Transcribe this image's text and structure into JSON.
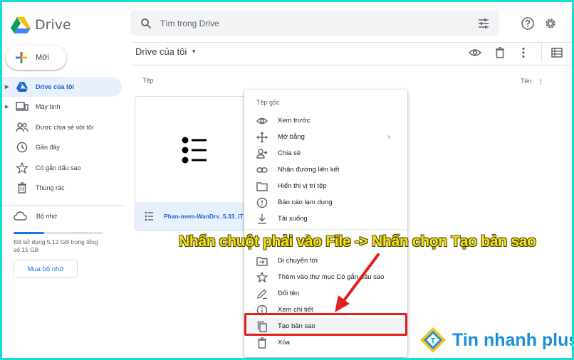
{
  "app": {
    "name": "Drive",
    "search_placeholder": "Tìm trong Drive"
  },
  "header_icons": [
    "search-icon",
    "tune-icon",
    "help-icon",
    "settings-icon"
  ],
  "sidebar": {
    "new_button": "Mới",
    "items": [
      {
        "label": "Drive của tôi",
        "icon": "drive-icon",
        "active": true,
        "has_caret": true
      },
      {
        "label": "Máy tính",
        "icon": "computer-icon",
        "active": false,
        "has_caret": true
      },
      {
        "label": "Được chia sẻ với tôi",
        "icon": "people-icon",
        "active": false,
        "has_caret": false
      },
      {
        "label": "Gần đây",
        "icon": "clock-icon",
        "active": false,
        "has_caret": false
      },
      {
        "label": "Có gắn dấu sao",
        "icon": "star-icon",
        "active": false,
        "has_caret": false
      },
      {
        "label": "Thùng rác",
        "icon": "trash-icon",
        "active": false,
        "has_caret": false
      }
    ],
    "storage": {
      "title": "Bộ nhớ",
      "used_text": "Đã sử dụng 5,12 GB trong tổng số 15 GB",
      "used_fraction": 0.34,
      "buy_button": "Mua bộ nhớ"
    }
  },
  "main": {
    "title": "Drive của tôi",
    "column_type": "Tệp",
    "column_name": "Tên",
    "file": {
      "name": "Phan-mem-WanDrv_5.33_iT"
    }
  },
  "context_menu": {
    "header": "Tệp gốc",
    "items": [
      {
        "label": "Xem trước",
        "icon": "eye-icon"
      },
      {
        "label": "Mở bằng",
        "icon": "move-icon",
        "submenu": true
      },
      {
        "label": "Chia sẻ",
        "icon": "person-add-icon"
      },
      {
        "label": "Nhận đường liên kết",
        "icon": "link-icon"
      },
      {
        "label": "Hiển thị vị trí tệp",
        "icon": "folder-icon"
      },
      {
        "label": "Báo cáo lạm dụng",
        "icon": "report-icon"
      },
      {
        "label": "Tải xuống",
        "icon": "download-icon"
      },
      {
        "label": "Di chuyển tới",
        "icon": "move-to-icon"
      },
      {
        "label": "Thêm vào thư mục Có gắn dấu sao",
        "icon": "star-icon"
      },
      {
        "label": "Đổi tên",
        "icon": "edit-icon"
      },
      {
        "label": "Xem chi tiết",
        "icon": "info-icon"
      },
      {
        "label": "Tạo bản sao",
        "icon": "copy-icon",
        "highlighted": true
      },
      {
        "label": "Xóa",
        "icon": "trash-icon"
      }
    ]
  },
  "annotation": "Nhấn chuột phải vào File -> Nhấn chọn Tạo bản sao",
  "watermark": "Tin nhanh plus",
  "colors": {
    "accent": "#1a73e8",
    "active_bg": "#e8f0fe",
    "highlight_border": "#e0201f",
    "annotation_text": "#f7e11a",
    "frame": "#12e0d6"
  }
}
